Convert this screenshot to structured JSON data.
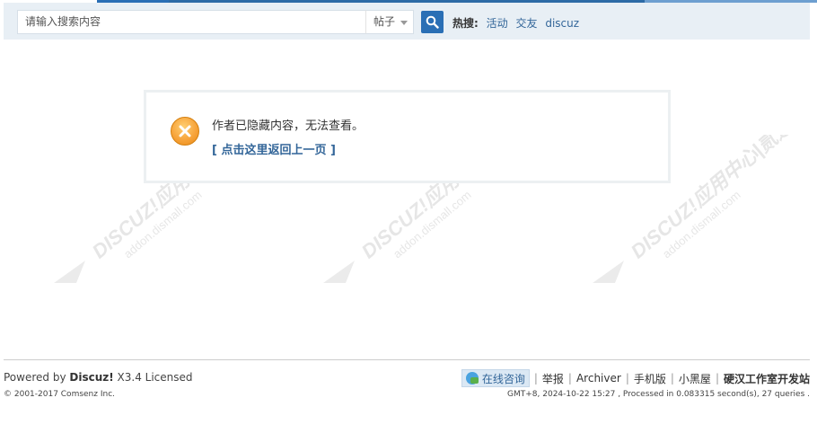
{
  "search": {
    "placeholder": "请输入搜索内容",
    "type_selected": "帖子"
  },
  "hot_search": {
    "label": "热搜:",
    "items": [
      "活动",
      "交友",
      "discuz"
    ]
  },
  "message": {
    "text": "作者已隐藏内容，无法查看。",
    "back_link": "[ 点击这里返回上一页 ]"
  },
  "footer": {
    "powered_prefix": "Powered by ",
    "powered_brand": "Discuz!",
    "powered_suffix": " X3.4 Licensed",
    "copyright": "© 2001-2017 Comsenz Inc.",
    "consult": "在线咨询",
    "links": [
      "举报",
      "Archiver",
      "手机版",
      "小黑屋"
    ],
    "site_name": "硬汉工作室开发站",
    "debug": "GMT+8, 2024-10-22 15:27 , Processed in 0.083315 second(s), 27 queries ."
  },
  "watermark": {
    "line1": "DISCUZ!应用中心|贰道",
    "line2": "addon.dismall.com"
  },
  "colors": {
    "accent": "#2a6fb5",
    "link": "#336699",
    "alert": "#f7a43b"
  }
}
